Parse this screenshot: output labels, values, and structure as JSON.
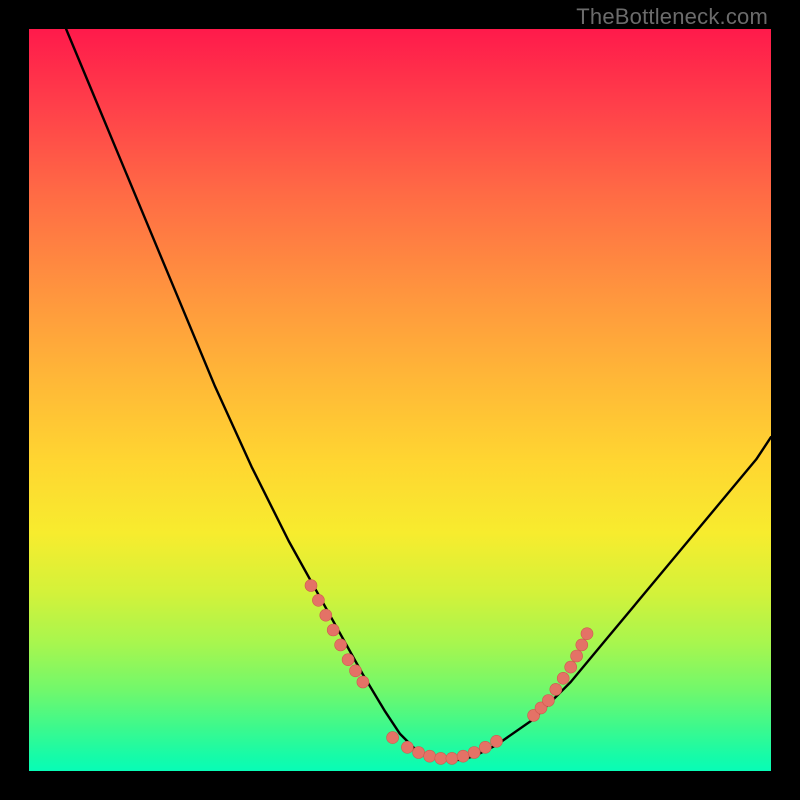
{
  "watermark": "TheBottleneck.com",
  "colors": {
    "background": "#000000",
    "gradient_top": "#ff1a4b",
    "gradient_bottom": "#08fcb6",
    "curve": "#000000",
    "dots": "#e47266"
  },
  "chart_data": {
    "type": "line",
    "title": "",
    "xlabel": "",
    "ylabel": "",
    "xlim": [
      0,
      100
    ],
    "ylim": [
      0,
      100
    ],
    "grid": false,
    "series": [
      {
        "name": "bottleneck-curve",
        "x": [
          5,
          10,
          15,
          20,
          25,
          30,
          35,
          40,
          45,
          48,
          50,
          52,
          54,
          56,
          58,
          60,
          63,
          68,
          73,
          78,
          83,
          88,
          93,
          98,
          100
        ],
        "y": [
          100,
          88,
          76,
          64,
          52,
          41,
          31,
          22,
          13,
          8,
          5,
          3,
          2,
          1.5,
          1.5,
          2,
          3.5,
          7,
          12,
          18,
          24,
          30,
          36,
          42,
          45
        ]
      }
    ],
    "markers": [
      {
        "name": "left-cluster-top",
        "x": 38,
        "y": 25
      },
      {
        "name": "left-cluster-1",
        "x": 39,
        "y": 23
      },
      {
        "name": "left-cluster-2",
        "x": 40,
        "y": 21
      },
      {
        "name": "left-cluster-3",
        "x": 41,
        "y": 19
      },
      {
        "name": "left-cluster-4",
        "x": 42,
        "y": 17
      },
      {
        "name": "left-cluster-5",
        "x": 43,
        "y": 15
      },
      {
        "name": "left-cluster-6",
        "x": 44,
        "y": 13.5
      },
      {
        "name": "left-cluster-bottom",
        "x": 45,
        "y": 12
      },
      {
        "name": "floor-1",
        "x": 49,
        "y": 4.5
      },
      {
        "name": "floor-2",
        "x": 51,
        "y": 3.2
      },
      {
        "name": "floor-3",
        "x": 52.5,
        "y": 2.5
      },
      {
        "name": "floor-4",
        "x": 54,
        "y": 2
      },
      {
        "name": "floor-5",
        "x": 55.5,
        "y": 1.7
      },
      {
        "name": "floor-6",
        "x": 57,
        "y": 1.7
      },
      {
        "name": "floor-7",
        "x": 58.5,
        "y": 2
      },
      {
        "name": "floor-8",
        "x": 60,
        "y": 2.5
      },
      {
        "name": "floor-9",
        "x": 61.5,
        "y": 3.2
      },
      {
        "name": "floor-10",
        "x": 63,
        "y": 4
      },
      {
        "name": "right-cluster-bottom",
        "x": 68,
        "y": 7.5
      },
      {
        "name": "right-cluster-1",
        "x": 69,
        "y": 8.5
      },
      {
        "name": "right-cluster-2",
        "x": 70,
        "y": 9.5
      },
      {
        "name": "right-cluster-3",
        "x": 71,
        "y": 11
      },
      {
        "name": "right-cluster-4",
        "x": 72,
        "y": 12.5
      },
      {
        "name": "right-cluster-5",
        "x": 73,
        "y": 14
      },
      {
        "name": "right-cluster-6",
        "x": 73.8,
        "y": 15.5
      },
      {
        "name": "right-cluster-7",
        "x": 74.5,
        "y": 17
      },
      {
        "name": "right-cluster-top",
        "x": 75.2,
        "y": 18.5
      }
    ]
  }
}
